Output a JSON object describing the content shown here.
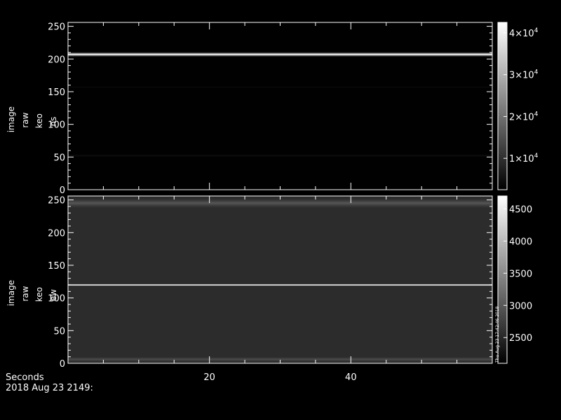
{
  "chart_data": [
    {
      "type": "heatmap",
      "name": "keogram-ns",
      "ylabel_lines": [
        "image",
        "raw",
        "keo",
        "ns"
      ],
      "ylim": [
        0,
        256
      ],
      "xlim": [
        0,
        60
      ],
      "yticks": [
        0,
        50,
        100,
        150,
        200,
        250
      ],
      "xticks": [
        20,
        40
      ],
      "colorbar": {
        "range": [
          2500,
          42500
        ],
        "ticks": [
          {
            "value": 10000,
            "mantissa": "1×10",
            "exp": "4"
          },
          {
            "value": 20000,
            "mantissa": "2×10",
            "exp": "4"
          },
          {
            "value": 30000,
            "mantissa": "3×10",
            "exp": "4"
          },
          {
            "value": 40000,
            "mantissa": "4×10",
            "exp": "4"
          }
        ]
      },
      "background_level": 2600,
      "bands": [
        {
          "row_center": 207,
          "width": 7,
          "level": 42000
        },
        {
          "row_center": 157,
          "width": 4,
          "level": 4000
        },
        {
          "row_center": 52,
          "width": 6,
          "level": 4500
        }
      ]
    },
    {
      "type": "heatmap",
      "name": "keogram-ew",
      "ylabel_lines": [
        "image",
        "raw",
        "keo",
        "ew"
      ],
      "ylim": [
        0,
        256
      ],
      "xlim": [
        0,
        60
      ],
      "yticks": [
        0,
        50,
        100,
        150,
        200,
        250
      ],
      "xticks": [
        20,
        40
      ],
      "colorbar": {
        "range": [
          2100,
          4700
        ],
        "ticks": [
          {
            "value": 2500,
            "label": "2500"
          },
          {
            "value": 3000,
            "label": "3000"
          },
          {
            "value": 3500,
            "label": "3500"
          },
          {
            "value": 4000,
            "label": "4000"
          },
          {
            "value": 4500,
            "label": "4500"
          }
        ]
      },
      "background_level": 2550,
      "bands": [
        {
          "row_center": 120,
          "width": 3,
          "level": 4700
        },
        {
          "row_center": 245,
          "width": 14,
          "level": 2950
        },
        {
          "row_center": 6,
          "width": 8,
          "level": 2850
        }
      ]
    }
  ],
  "footer": {
    "axis_title": "Seconds",
    "date_label": "2018 Aug 23 2149:"
  },
  "stamp": "Thu Aug 23 17:42:46 2018",
  "colors": {
    "background": "#000000",
    "axes": "#ffffff",
    "text": "#ffffff"
  }
}
